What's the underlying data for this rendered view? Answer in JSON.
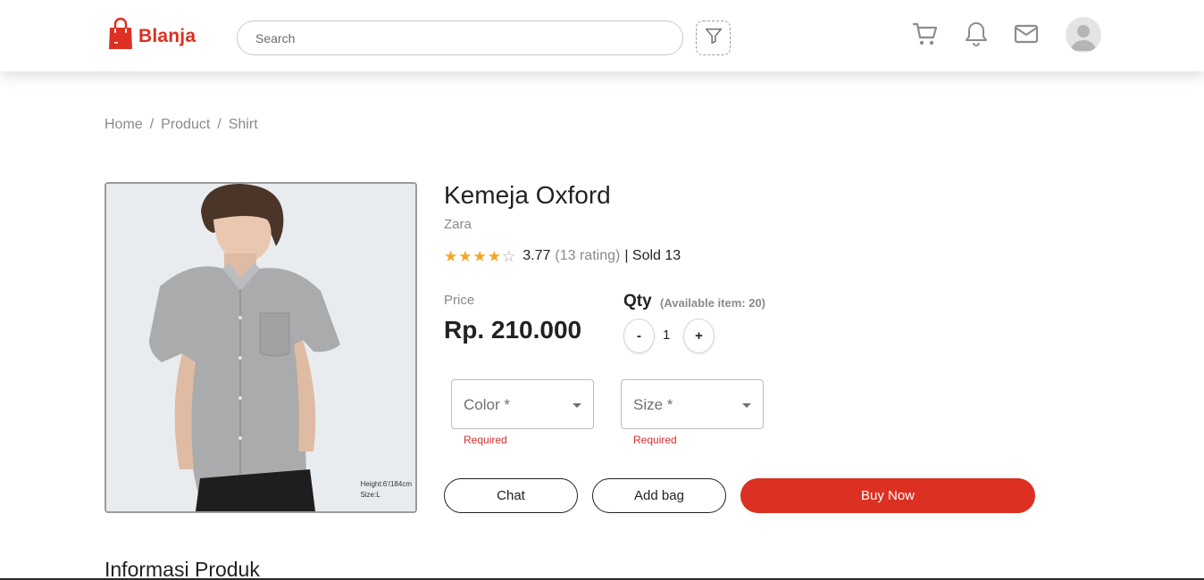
{
  "brand": {
    "logo_text": "Blanja",
    "accent_color": "#DB3022"
  },
  "navbar": {
    "search_placeholder": "Search",
    "icons": [
      "filter-icon",
      "cart-icon",
      "bell-icon",
      "mail-icon",
      "avatar"
    ]
  },
  "breadcrumb": {
    "items": [
      "Home",
      "Product",
      "Shirt"
    ],
    "separator": "/"
  },
  "product": {
    "image_caption_line1": "Height:6'/184cm",
    "image_caption_line2": "Size:L",
    "title": "Kemeja Oxford",
    "brand": "Zara",
    "rating_value": "3.77",
    "stars_filled": 4,
    "stars_total": 5,
    "rating_count": "(13 rating)",
    "sold": "| Sold 13",
    "price_label": "Price",
    "price_value": "Rp. 210.000",
    "qty_label": "Qty",
    "qty_available": "(Available item: 20)",
    "qty_minus": "-",
    "qty_value": "1",
    "qty_plus": "+",
    "color_label": "Color *",
    "size_label": "Size *",
    "required_text": "Required",
    "chat_label": "Chat",
    "add_bag_label": "Add bag",
    "buy_now_label": "Buy Now"
  },
  "sections": {
    "info_title": "Informasi Produk"
  }
}
